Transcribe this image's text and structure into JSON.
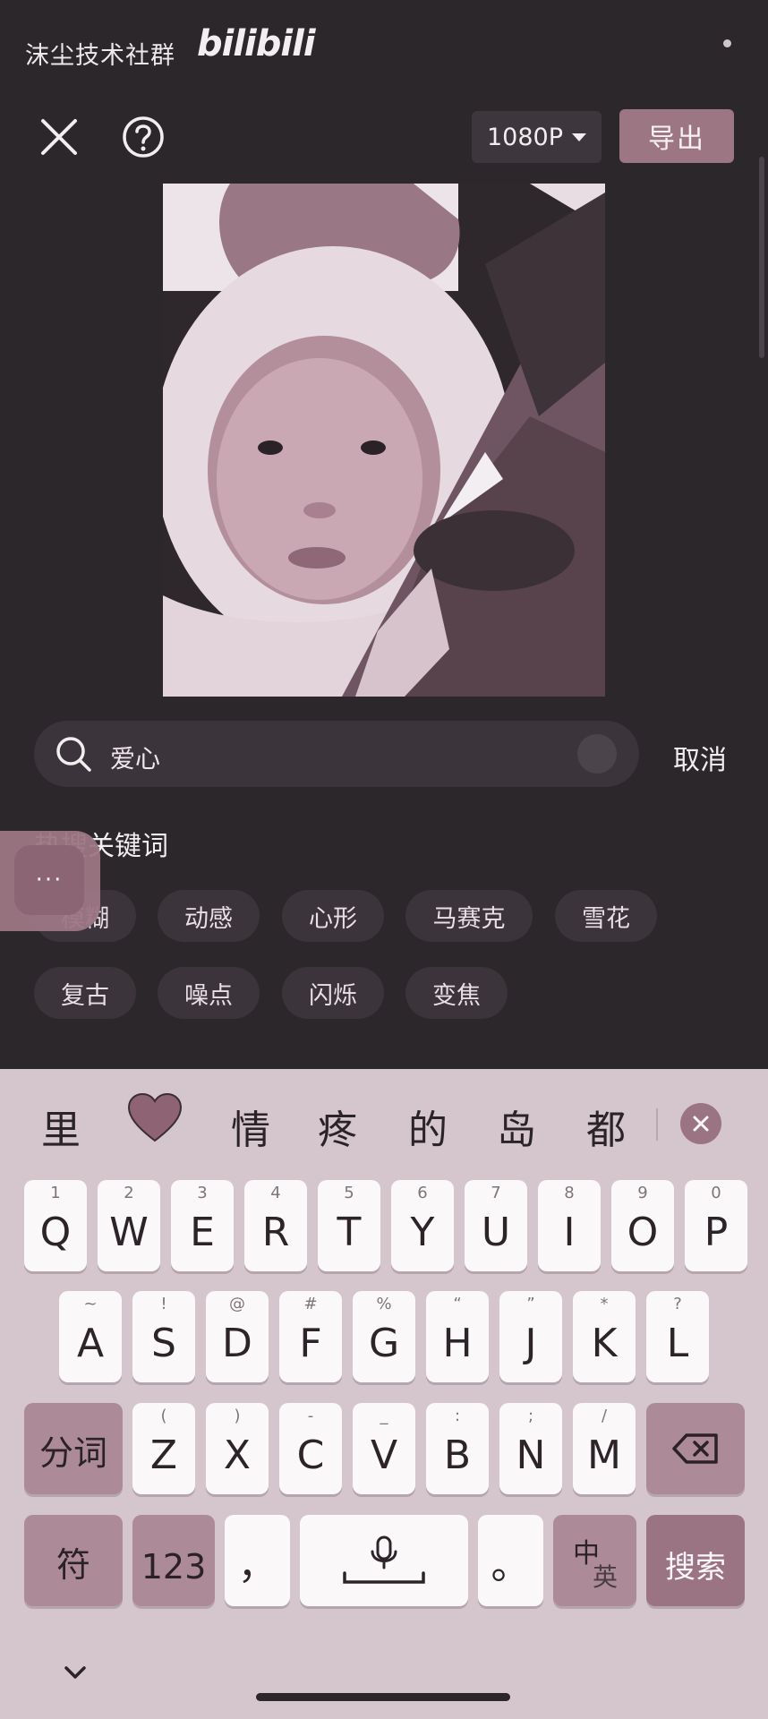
{
  "header": {
    "watermark_text": "沫尘技术社群",
    "logo_text": "bilibili"
  },
  "toolbar": {
    "resolution_label": "1080P",
    "export_label": "导出"
  },
  "search": {
    "value": "爱心",
    "cancel_label": "取消"
  },
  "hot_keywords": {
    "title": "热搜关键词",
    "items": [
      "模糊",
      "动感",
      "心形",
      "马赛克",
      "雪花",
      "复古",
      "噪点",
      "闪烁",
      "变焦"
    ]
  },
  "floating_menu": {
    "label": "···"
  },
  "keyboard": {
    "candidates": [
      "里",
      "❤",
      "情",
      "疼",
      "的",
      "岛",
      "都"
    ],
    "row1": [
      {
        "key": "Q",
        "hint": "1"
      },
      {
        "key": "W",
        "hint": "2"
      },
      {
        "key": "E",
        "hint": "3"
      },
      {
        "key": "R",
        "hint": "4"
      },
      {
        "key": "T",
        "hint": "5"
      },
      {
        "key": "Y",
        "hint": "6"
      },
      {
        "key": "U",
        "hint": "7"
      },
      {
        "key": "I",
        "hint": "8"
      },
      {
        "key": "O",
        "hint": "9"
      },
      {
        "key": "P",
        "hint": "0"
      }
    ],
    "row2": [
      {
        "key": "A",
        "hint": "~"
      },
      {
        "key": "S",
        "hint": "!"
      },
      {
        "key": "D",
        "hint": "@"
      },
      {
        "key": "F",
        "hint": "#"
      },
      {
        "key": "G",
        "hint": "%"
      },
      {
        "key": "H",
        "hint": "“"
      },
      {
        "key": "J",
        "hint": "”"
      },
      {
        "key": "K",
        "hint": "*"
      },
      {
        "key": "L",
        "hint": "?"
      }
    ],
    "row3": [
      {
        "key": "Z",
        "hint": "("
      },
      {
        "key": "X",
        "hint": ")"
      },
      {
        "key": "C",
        "hint": "-"
      },
      {
        "key": "V",
        "hint": "_"
      },
      {
        "key": "B",
        "hint": ":"
      },
      {
        "key": "N",
        "hint": ";"
      },
      {
        "key": "M",
        "hint": "/"
      }
    ],
    "segment_label": "分词",
    "symbol_label": "符",
    "numbers_label": "123",
    "comma_label": "，",
    "period_label": "。",
    "lang_zh": "中",
    "lang_en": "英",
    "search_label": "搜索"
  },
  "colors": {
    "accent": "#9d7683",
    "background": "#2b272b",
    "keyboard": "#d5c5cc"
  }
}
